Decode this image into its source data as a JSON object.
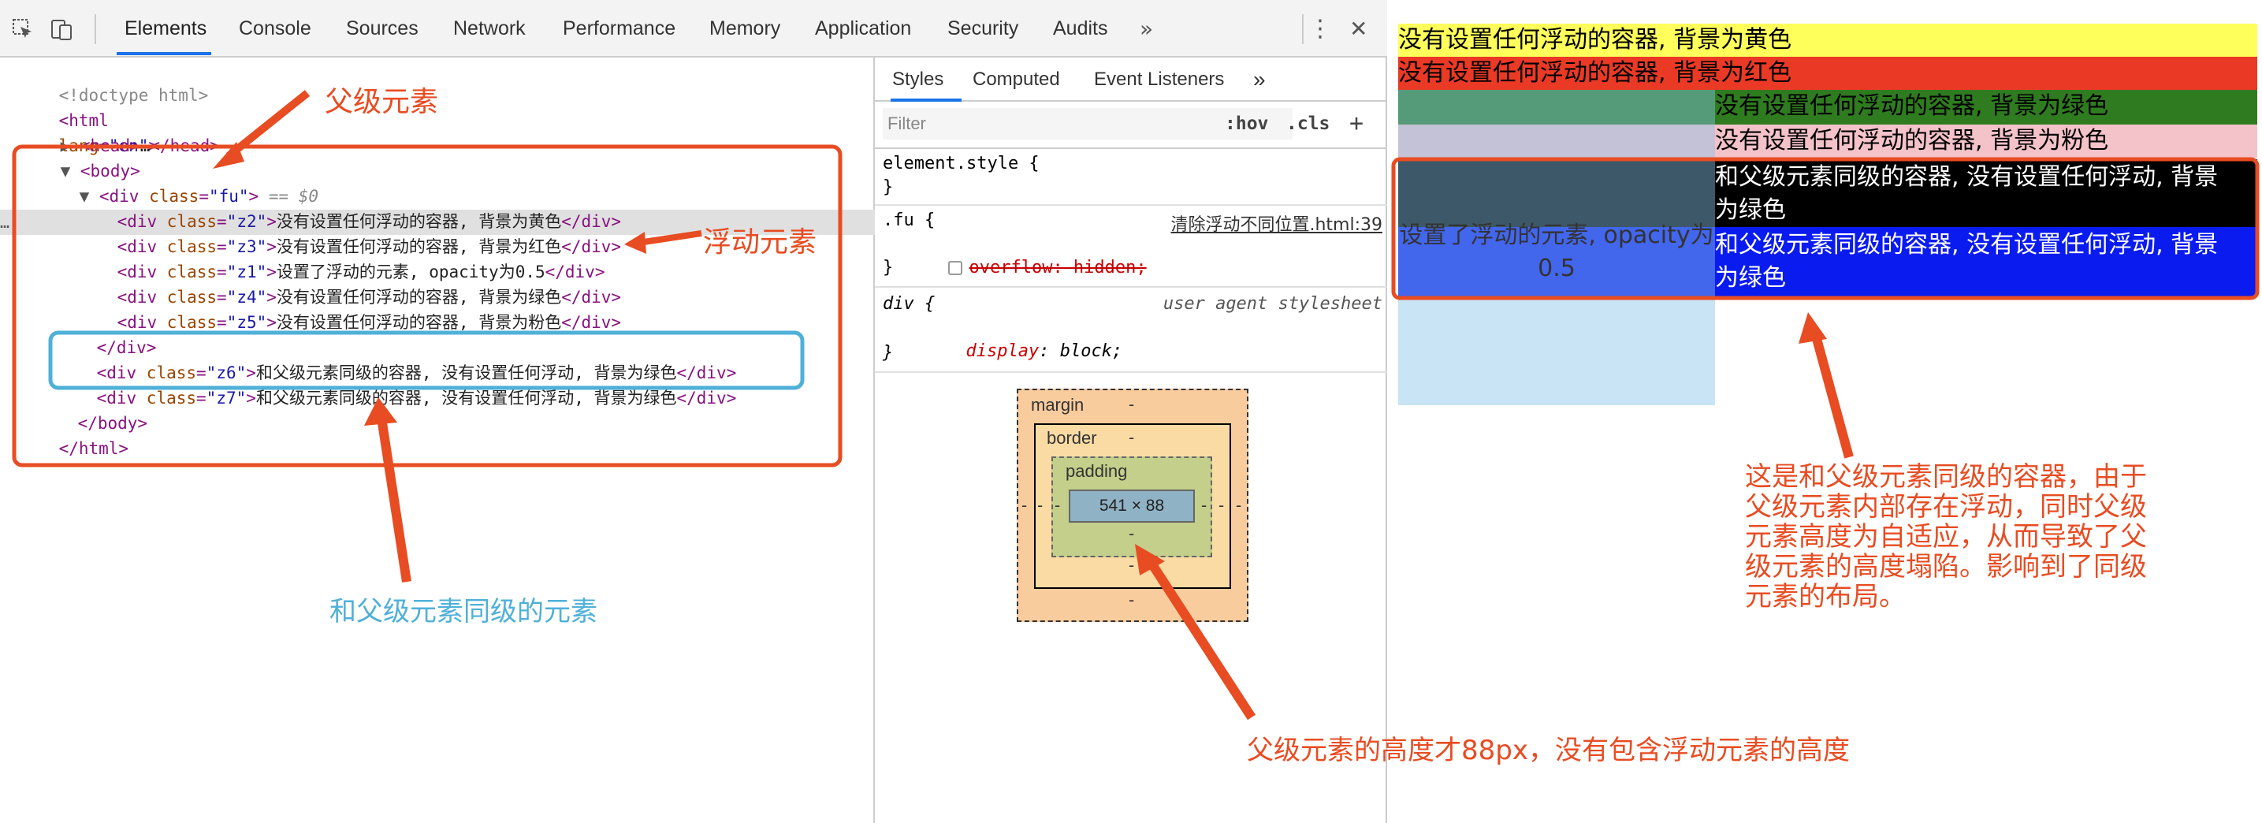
{
  "toolbar": {
    "tabs": [
      "Elements",
      "Console",
      "Sources",
      "Network",
      "Performance",
      "Memory",
      "Application",
      "Security",
      "Audits"
    ],
    "more": "»",
    "menu": "⋮",
    "close": "✕"
  },
  "dom": {
    "lines": [
      {
        "pre": "",
        "tag_open": "<!doctype html>"
      },
      {
        "pre": "",
        "text": "html lang=\"en\""
      },
      {
        "pre": "",
        "text": "head…/head"
      },
      {
        "pre": "",
        "text": "body"
      }
    ],
    "doctype": "<!doctype html>",
    "html_tag": "html",
    "lang_attr": "lang",
    "lang_val": "\"en\"",
    "head_text": "…",
    "body_tag": "body",
    "fu_class": "\"fu\"",
    "fu_suffix": "== $0",
    "children": [
      {
        "cls": "\"z2\"",
        "text": "没有设置任何浮动的容器, 背景为黄色"
      },
      {
        "cls": "\"z3\"",
        "text": "没有设置任何浮动的容器, 背景为红色"
      },
      {
        "cls": "\"z1\"",
        "text": "设置了浮动的元素, opacity为0.5"
      },
      {
        "cls": "\"z4\"",
        "text": "没有设置任何浮动的容器, 背景为绿色"
      },
      {
        "cls": "\"z5\"",
        "text": "没有设置任何浮动的容器, 背景为粉色"
      }
    ],
    "siblings": [
      {
        "cls": "\"z6\"",
        "text": "和父级元素同级的容器, 没有设置任何浮动, 背景为绿色"
      },
      {
        "cls": "\"z7\"",
        "text": "和父级元素同级的容器, 没有设置任何浮动, 背景为绿色"
      }
    ]
  },
  "styles": {
    "tabs": [
      "Styles",
      "Computed",
      "Event Listeners"
    ],
    "more": "»",
    "filter_placeholder": "Filter",
    "hov": ":hov",
    "cls": ".cls",
    "plus": "+",
    "element_style": "element.style {",
    "close_brace": "}",
    "fu_selector": ".fu {",
    "fu_source": "清除浮动不同位置.html:39",
    "fu_prop": "overflow: hidden;",
    "div_selector": "div {",
    "div_source": "user agent stylesheet",
    "div_prop_name": "display",
    "div_prop_value": "block;",
    "box_model": {
      "margin": "margin",
      "border": "border",
      "padding": "padding",
      "content": "541 × 88",
      "dash": "-"
    }
  },
  "page": {
    "blocks": [
      {
        "text": "没有设置任何浮动的容器, 背景为黄色",
        "color": "#ffff5b"
      },
      {
        "text": "没有设置任何浮动的容器, 背景为红色",
        "color": "#ea3a25"
      },
      {
        "text": "没有设置任何浮动的容器, 背景为绿色",
        "color": "#2f7b1f"
      },
      {
        "text": "没有设置任何浮动的容器, 背景为粉色",
        "color": "#f4c2c9"
      }
    ],
    "float_text": "设置了浮动的元素, opacity为0.5",
    "z6_text_1": "和父级元素同级的容器, 没有设置任何浮动, 背景",
    "z6_text_2": "为绿色",
    "z7_text_1": "和父级元素同级的容器, 没有设置任何浮动, 背景",
    "z7_text_2": "为绿色"
  },
  "annotations": {
    "parent": "父级元素",
    "floating": "浮动元素",
    "sibling": "和父级元素同级的元素",
    "height": "父级元素的高度才88px，没有包含浮动元素的高度",
    "explain": [
      "这是和父级元素同级的容器，由于",
      "父级元素内部存在浮动，同时父级",
      "元素高度为自适应，从而导致了父",
      "级元素的高度塌陷。影响到了同级",
      "元素的布局。"
    ]
  },
  "colors": {
    "annotation_red": "#e84c22",
    "annotation_blue": "#4fb0d8",
    "selected_tab": "#1a73e8"
  }
}
